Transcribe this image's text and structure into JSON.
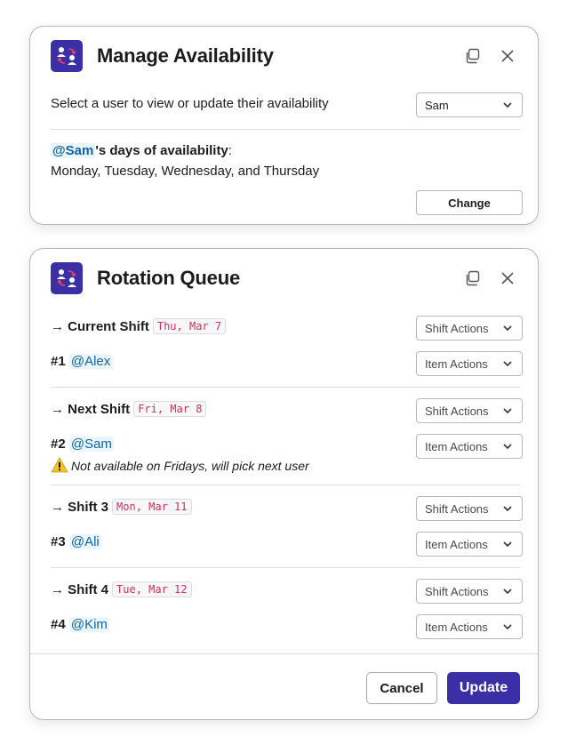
{
  "colors": {
    "brand": "#3b2fa5",
    "mention_bg": "#e8f5fa",
    "mention_text": "#1264a3",
    "date_text": "#d72b5d"
  },
  "availability_modal": {
    "title": "Manage Availability",
    "prompt": "Select a user to view or update their availability",
    "user_select": {
      "value": "Sam"
    },
    "mention": "@Sam",
    "days_suffix": "'s days of availability",
    "days_colon": ":",
    "days_list": "Monday, Tuesday, Wednesday, and Thursday",
    "change_label": "Change",
    "icons": {
      "app": "app-icon",
      "copy": "copy-icon",
      "close": "close-icon"
    }
  },
  "rotation_modal": {
    "title": "Rotation Queue",
    "arrow": "→",
    "shift_actions_label": "Shift Actions",
    "item_actions_label": "Item Actions",
    "shifts": [
      {
        "label": "Current Shift",
        "date": "Thu, Mar 7",
        "rank": "#1",
        "user": "@Alex"
      },
      {
        "label": "Next Shift",
        "date": "Fri, Mar 8",
        "rank": "#2",
        "user": "@Sam",
        "warning": "Not available on Fridays, will pick next user"
      },
      {
        "label": "Shift 3",
        "date": "Mon, Mar 11",
        "rank": "#3",
        "user": "@Ali"
      },
      {
        "label": "Shift 4",
        "date": "Tue, Mar 12",
        "rank": "#4",
        "user": "@Kim"
      }
    ],
    "cancel_label": "Cancel",
    "update_label": "Update"
  }
}
